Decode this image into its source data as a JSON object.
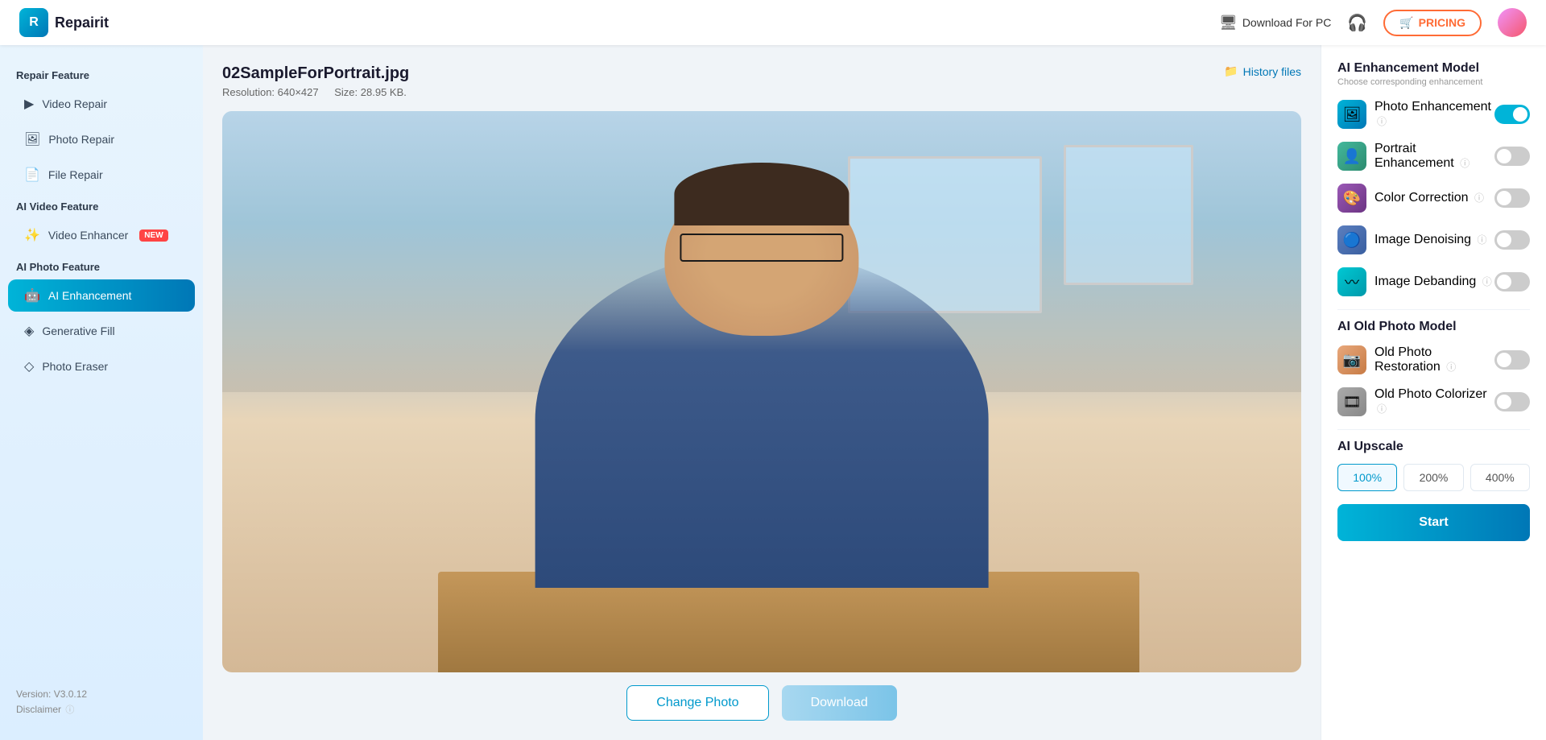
{
  "app": {
    "name": "Repairit",
    "logo_letter": "R"
  },
  "topnav": {
    "download_pc": "Download For PC",
    "pricing": "PRICING",
    "cart_icon": "🛒"
  },
  "sidebar": {
    "repair_feature_label": "Repair Feature",
    "ai_video_feature_label": "AI Video Feature",
    "ai_photo_feature_label": "AI Photo Feature",
    "items": [
      {
        "id": "video-repair",
        "label": "Video Repair",
        "icon": "▶",
        "active": false,
        "new": false
      },
      {
        "id": "photo-repair",
        "label": "Photo Repair",
        "icon": "🖼",
        "active": false,
        "new": false
      },
      {
        "id": "file-repair",
        "label": "File Repair",
        "icon": "📄",
        "active": false,
        "new": false
      },
      {
        "id": "video-enhancer",
        "label": "Video Enhancer",
        "icon": "✨",
        "active": false,
        "new": true
      },
      {
        "id": "ai-enhancement",
        "label": "AI Enhancement",
        "icon": "AI",
        "active": true,
        "new": false
      },
      {
        "id": "generative-fill",
        "label": "Generative Fill",
        "icon": "◈",
        "active": false,
        "new": false
      },
      {
        "id": "photo-eraser",
        "label": "Photo Eraser",
        "icon": "◇",
        "active": false,
        "new": false
      }
    ],
    "version": "Version: V3.0.12",
    "disclaimer": "Disclaimer"
  },
  "content": {
    "filename": "02SampleForPortrait.jpg",
    "resolution_label": "Resolution: 640×427",
    "size_label": "Size: 28.95 KB.",
    "history_files": "History files",
    "change_photo": "Change Photo",
    "download": "Download"
  },
  "right_panel": {
    "ai_enhancement_model_title": "AI Enhancement Model",
    "ai_enhancement_model_subtitle": "Choose corresponding enhancement",
    "photo_enhancement_label": "Photo Enhancement",
    "portrait_enhancement_label": "Portrait Enhancement",
    "color_correction_label": "Color Correction",
    "image_denoising_label": "Image Denoising",
    "image_debanding_label": "Image Debanding",
    "ai_old_photo_model_title": "AI Old Photo Model",
    "old_photo_restoration_label": "Old Photo Restoration",
    "old_photo_colorizer_label": "Old Photo Colorizer",
    "ai_upscale_title": "AI Upscale",
    "upscale_options": [
      "100%",
      "200%",
      "400%"
    ],
    "upscale_active": "100%",
    "start_button": "Start",
    "toggles": {
      "photo_enhancement": true,
      "portrait_enhancement": false,
      "color_correction": false,
      "image_denoising": false,
      "image_debanding": false,
      "old_photo_restoration": false,
      "old_photo_colorizer": false
    }
  }
}
